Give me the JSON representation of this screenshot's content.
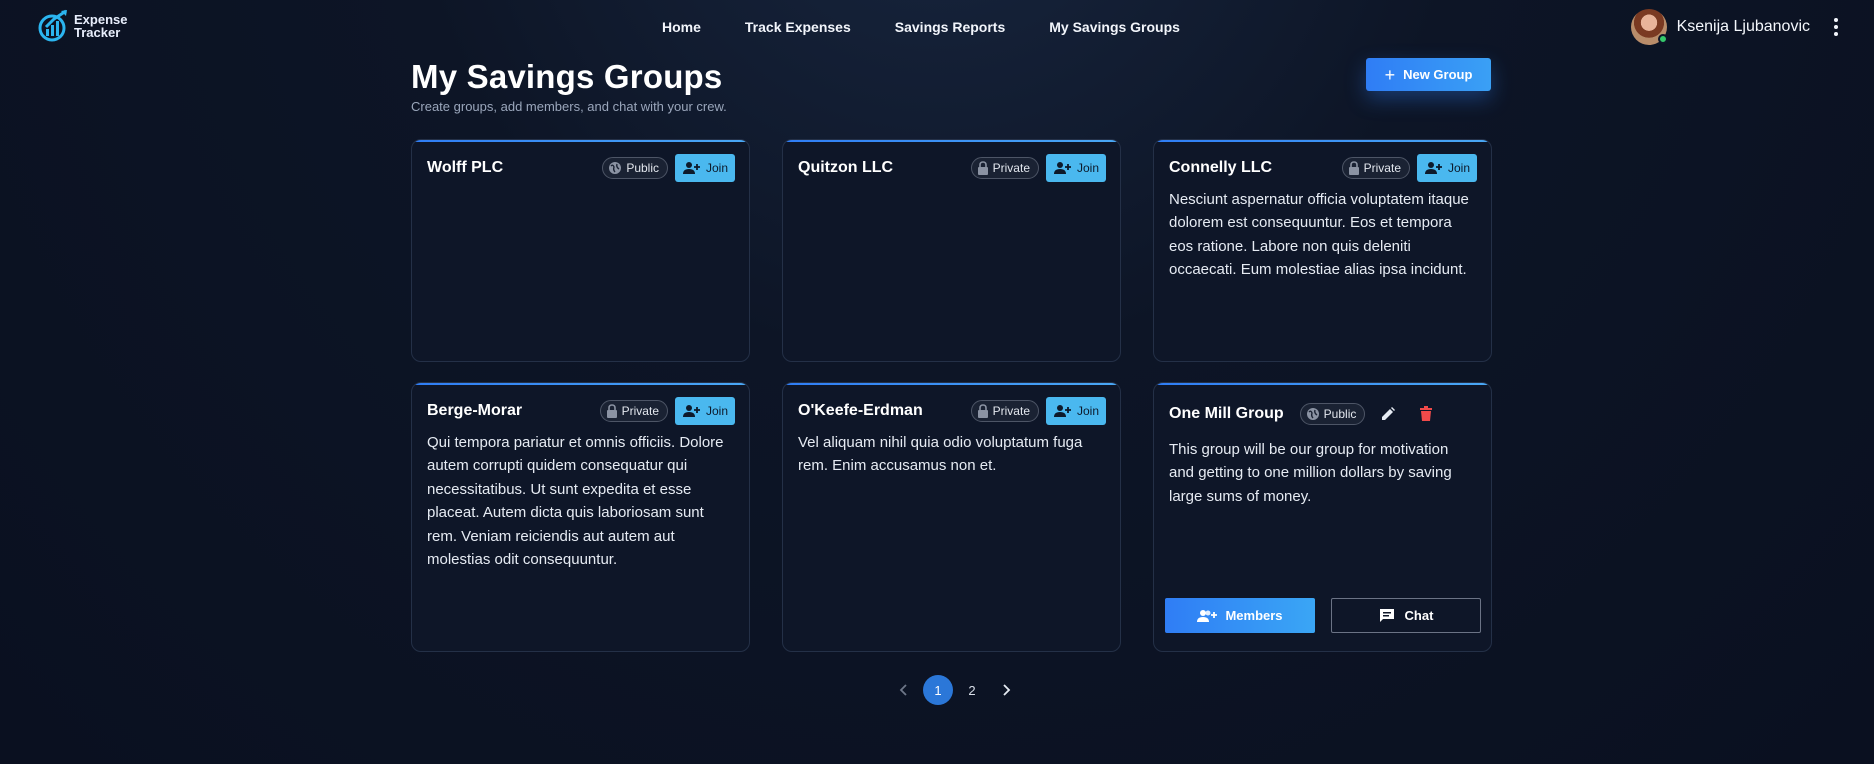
{
  "brand": {
    "line1": "Expense",
    "line2": "Tracker",
    "colors": {
      "accent": "#2bb5f0"
    }
  },
  "nav": [
    {
      "label": "Home"
    },
    {
      "label": "Track Expenses"
    },
    {
      "label": "Savings Reports"
    },
    {
      "label": "My Savings Groups"
    }
  ],
  "user": {
    "name": "Ksenija Ljubanovic",
    "status": "online"
  },
  "header": {
    "title": "My Savings Groups",
    "subtitle": "Create groups, add members, and chat with your crew.",
    "new_group_label": "New Group"
  },
  "groups": [
    {
      "name": "Wolff PLC",
      "visibility": "Public",
      "action": "Join",
      "description": ""
    },
    {
      "name": "Quitzon LLC",
      "visibility": "Private",
      "action": "Join",
      "description": ""
    },
    {
      "name": "Connelly LLC",
      "visibility": "Private",
      "action": "Join",
      "description": "Nesciunt aspernatur officia voluptatem itaque dolorem est consequuntur. Eos et tempora eos ratione. Labore non quis deleniti occaecati. Eum molestiae alias ipsa incidunt."
    },
    {
      "name": "Berge-Morar",
      "visibility": "Private",
      "action": "Join",
      "description": "Qui tempora pariatur et omnis officiis. Dolore autem corrupti quidem consequatur qui necessitatibus. Ut sunt expedita et esse placeat. Autem dicta quis laboriosam sunt rem. Veniam reiciendis aut autem aut molestias odit consequuntur."
    },
    {
      "name": "O'Keefe-Erdman",
      "visibility": "Private",
      "action": "Join",
      "description": "Vel aliquam nihil quia odio voluptatum fuga rem. Enim accusamus non et."
    },
    {
      "name": "One Mill Group",
      "visibility": "Public",
      "description": "This group will be our group for motivation and getting to one million dollars by saving large sums of money.",
      "members_label": "Members",
      "chat_label": "Chat"
    }
  ],
  "pagination": {
    "pages": [
      "1",
      "2"
    ],
    "current": "1"
  },
  "colors": {
    "primary": "#2f7df5",
    "join": "#4ab8ef",
    "delete": "#f04a4a"
  }
}
